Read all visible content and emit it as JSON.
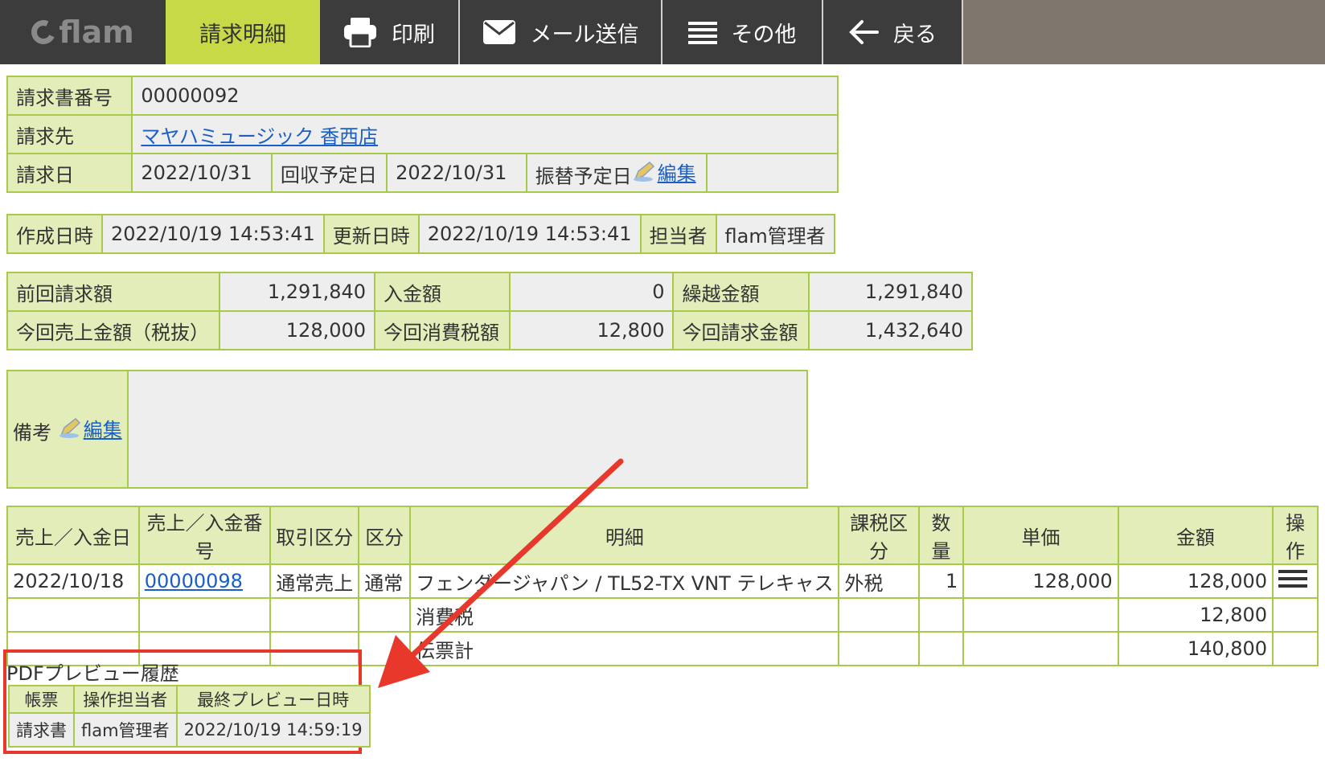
{
  "nav": {
    "logo": "flam",
    "tabs": [
      {
        "label": "請求明細",
        "icon": "none"
      },
      {
        "label": "印刷",
        "icon": "printer-icon"
      },
      {
        "label": "メール送信",
        "icon": "envelope-icon"
      },
      {
        "label": "その他",
        "icon": "menu-icon"
      },
      {
        "label": "戻る",
        "icon": "arrow-left-icon"
      }
    ]
  },
  "invoice": {
    "number_label": "請求書番号",
    "number": "00000092",
    "billto_label": "請求先",
    "billto": "マヤハミュージック 香西店",
    "date_label": "請求日",
    "date": "2022/10/31",
    "collect_label": "回収予定日",
    "collect_date": "2022/10/31",
    "transfer_label": "振替予定日",
    "edit_label": "編集"
  },
  "meta": {
    "created_label": "作成日時",
    "created": "2022/10/19 14:53:41",
    "updated_label": "更新日時",
    "updated": "2022/10/19 14:53:41",
    "staff_label": "担当者",
    "staff": "flam管理者"
  },
  "amounts": {
    "prev_label": "前回請求額",
    "prev": "1,291,840",
    "paid_label": "入金額",
    "paid": "0",
    "carry_label": "繰越金額",
    "carry": "1,291,840",
    "sales_label": "今回売上金額（税抜）",
    "sales": "128,000",
    "tax_label": "今回消費税額",
    "tax": "12,800",
    "total_label": "今回請求金額",
    "total": "1,432,640"
  },
  "notes": {
    "label": "備考",
    "edit_label": "編集",
    "value": ""
  },
  "items": {
    "headers": [
      "売上／入金日",
      "売上／入金番号",
      "取引区分",
      "区分",
      "明細",
      "課税区分",
      "数量",
      "単価",
      "金額",
      "操作"
    ],
    "row": {
      "date": "2022/10/18",
      "number": "00000098",
      "type": "通常売上",
      "category": "通常",
      "detail": "フェンダージャパン / TL52-TX VNT テレキャス",
      "tax_type": "外税",
      "qty": "1",
      "unit_price": "128,000",
      "amount": "128,000"
    },
    "tax_row": {
      "label": "消費税",
      "amount": "12,800"
    },
    "total_row": {
      "label": "伝票計",
      "amount": "140,800"
    }
  },
  "pdf_history": {
    "title": "PDFプレビュー履歴",
    "headers": [
      "帳票",
      "操作担当者",
      "最終プレビュー日時"
    ],
    "row": {
      "doc": "請求書",
      "operator": "flam管理者",
      "datetime": "2022/10/19 14:59:19"
    }
  },
  "colors": {
    "accent": "#c7d947",
    "label_bg": "#e2edb9",
    "border": "#a8c94a",
    "highlight": "#e8382c"
  }
}
